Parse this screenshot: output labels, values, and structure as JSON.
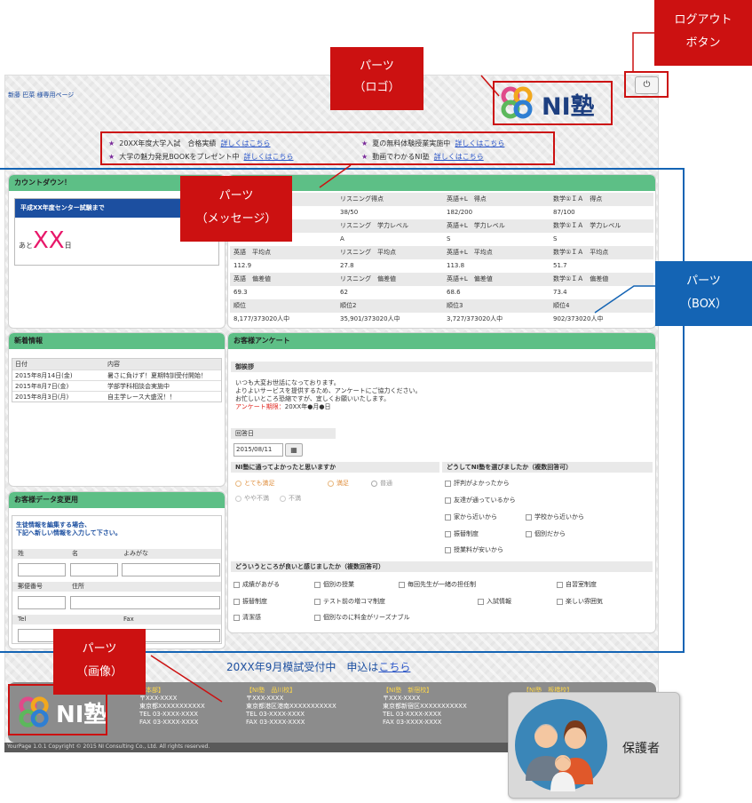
{
  "header": {
    "user_label": "新藤 巴菜 様専用ページ",
    "logo_text": "NI塾"
  },
  "announcements": [
    {
      "text": "20XX年度大学入試　合格実績",
      "link": "詳しくはこちら"
    },
    {
      "text": "夏の無料体験授業実施中",
      "link": "詳しくはこちら"
    },
    {
      "text": "大学の魅力発見BOOKをプレゼント中",
      "link": "詳しくはこちら"
    },
    {
      "text": "動画でわかるNI塾",
      "link": "詳しくはこちら"
    }
  ],
  "countdown": {
    "title": "カウントダウン！",
    "event": "平成XX年度センター試験まで",
    "prefix": "あと",
    "value": "XX",
    "suffix": "日"
  },
  "scores": {
    "rows": [
      [
        "",
        "リスニング得点",
        "英語+L　得点",
        "数学①ＩＡ　得点"
      ],
      [
        "",
        "38/50",
        "182/200",
        "87/100"
      ],
      [
        "",
        "リスニング　学力レベル",
        "英語+L　学力レベル",
        "数学①ＩＡ　学力レベル"
      ],
      [
        "S",
        "A",
        "S",
        "S"
      ],
      [
        "英語　平均点",
        "リスニング　平均点",
        "英語+L　平均点",
        "数学①ＩＡ　平均点"
      ],
      [
        "112.9",
        "27.8",
        "113.8",
        "51.7"
      ],
      [
        "英語　偏差値",
        "リスニング　偏差値",
        "英語+L　偏差値",
        "数学①ＩＡ　偏差値"
      ],
      [
        "69.3",
        "62",
        "68.6",
        "73.4"
      ],
      [
        "順位",
        "順位2",
        "順位3",
        "順位4"
      ],
      [
        "8,177/373020人中",
        "35,901/373020人中",
        "3,727/373020人中",
        "902/373020人中"
      ]
    ]
  },
  "news": {
    "title": "新着情報",
    "col_date": "日付",
    "col_content": "内容",
    "items": [
      {
        "date": "2015年8月14日(金)",
        "content": "暑さに負けず！夏期特訓受付開始！"
      },
      {
        "date": "2015年8月7日(金)",
        "content": "学部学科相談会実施中"
      },
      {
        "date": "2015年8月3日(月)",
        "content": "自主学レース大盛況！！"
      }
    ]
  },
  "customer": {
    "title": "お客様データ変更用",
    "intro1": "生徒情報を編集する場合、",
    "intro2": "下記へ新しい情報を入力して下さい。",
    "sei": "姓",
    "mei": "名",
    "yomi": "よみがな",
    "zip": "郵便番号",
    "address": "住所",
    "tel": "Tel",
    "fax": "Fax"
  },
  "survey": {
    "title": "お客様アンケート",
    "greeting_title": "御挨拶",
    "greeting1": "いつも大変お世話になっております。",
    "greeting2": "よりよいサービスを提供するため、アンケートにご協力ください。",
    "greeting3": "お忙しいところ恐縮ですが、宜しくお願いいたします。",
    "deadline_label": "アンケート期限：",
    "deadline_value": "20XX年●月●日",
    "answer_date_label": "回答日",
    "answer_date": "2015/08/11",
    "q1": "NI塾に通ってよかったと思いますか",
    "q1_options": [
      "とても満足",
      "満足",
      "普通",
      "やや不満",
      "不満"
    ],
    "q2": "どうしてNI塾を選びましたか（複数回答可）",
    "q2_options": [
      "評判がよかったから",
      "友達が通っているから",
      "家から近いから",
      "学校から近いから",
      "振替制度",
      "個別だから",
      "授業料が安いから"
    ],
    "q3": "どういうところが良いと感じましたか（複数回答可）",
    "q3_options": [
      "成績があがる",
      "個別の授業",
      "毎回先生が一緒の担任制",
      "自習室制度",
      "振替制度",
      "テスト前の増コマ制度",
      "入試情報",
      "楽しい雰囲気",
      "清潔感",
      "個別なのに料金がリーズナブル"
    ]
  },
  "promo": {
    "text": "20XX年9月模試受付中　申込は",
    "link": "こちら"
  },
  "footer": {
    "logo_text": "NI塾",
    "copyright": "YourPage 1.0.1 Copyright © 2015 NI Consulting Co., Ltd. All rights reserved.",
    "offices": [
      {
        "name": "【本部】",
        "zip": "〒XXX-XXXX",
        "addr": "東京都XXXXXXXXXXX",
        "tel": "TEL 03-XXXX-XXXX",
        "fax": "FAX  03-XXXX-XXXX"
      },
      {
        "name": "【NI塾　品川校】",
        "zip": "〒XXX-XXXX",
        "addr": "東京都港区港南XXXXXXXXXXX",
        "tel": "TEL 03-XXXX-XXXX",
        "fax": "FAX  03-XXXX-XXXX"
      },
      {
        "name": "【NI塾　新宿校】",
        "zip": "〒XXX-XXXX",
        "addr": "東京都新宿区XXXXXXXXXXX",
        "tel": "TEL 03-XXXX-XXXX",
        "fax": "FAX  03-XXXX-XXXX"
      },
      {
        "name": "【NI塾　板橋校】",
        "zip": "",
        "addr": "",
        "tel": "",
        "fax": ""
      }
    ]
  },
  "annotations": {
    "logout_1": "ログアウト",
    "logout_2": "ボタン",
    "logo_1": "パーツ",
    "logo_2": "（ロゴ）",
    "msg_1": "パーツ",
    "msg_2": "（メッセージ）",
    "box_1": "パーツ",
    "box_2": "（BOX）",
    "img_1": "パーツ",
    "img_2": "（画像）",
    "guardian": "保護者"
  },
  "colors": {
    "header_green": "#5dbf86",
    "annotation_red": "#cc1111",
    "annotation_blue": "#1464b4"
  }
}
